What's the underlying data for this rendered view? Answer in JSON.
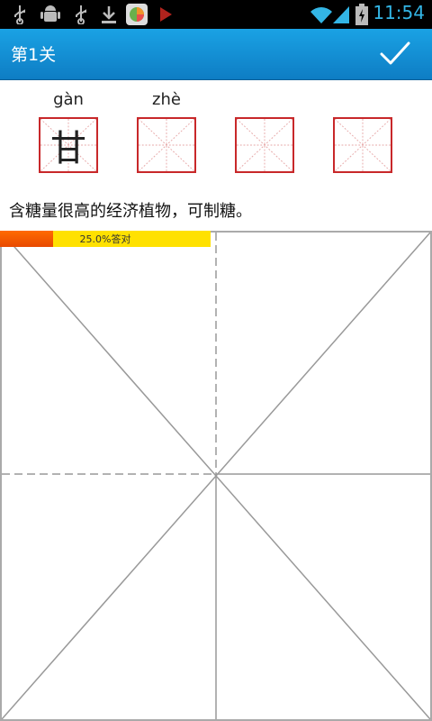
{
  "status_bar": {
    "time": "11:54",
    "icons": [
      "usb-icon",
      "android-debug-icon",
      "usb-icon",
      "download-icon",
      "app-icon",
      "play-icon",
      "wifi-icon",
      "signal-icon",
      "battery-charging-icon"
    ]
  },
  "header": {
    "title": "第1关",
    "confirm_icon": "checkmark-icon",
    "background": "#1396d8"
  },
  "boxes": [
    {
      "pinyin": "gàn",
      "char": "甘"
    },
    {
      "pinyin": "zhè",
      "char": ""
    },
    {
      "pinyin": "",
      "char": ""
    },
    {
      "pinyin": "",
      "char": ""
    }
  ],
  "sentence": "含糖量很高的经济植物，可制糖。",
  "progress": {
    "label": "25.0%答对",
    "percent": 25.0
  }
}
